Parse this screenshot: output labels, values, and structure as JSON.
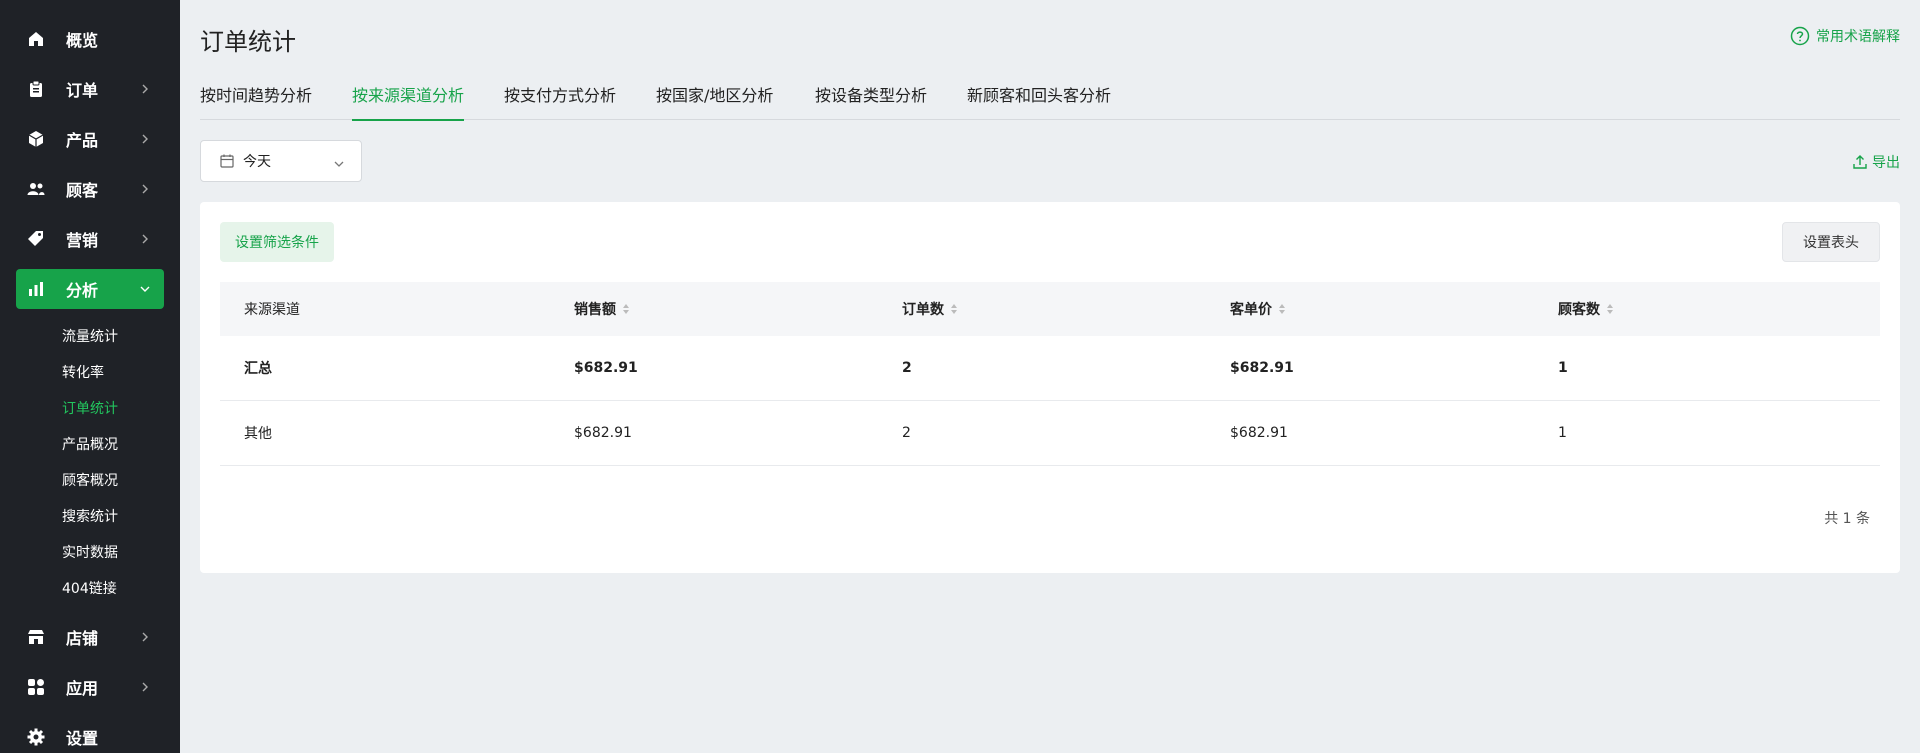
{
  "sidebar": {
    "items": [
      {
        "label": "概览",
        "icon": "home-icon"
      },
      {
        "label": "订单",
        "icon": "clipboard-icon"
      },
      {
        "label": "产品",
        "icon": "box-icon"
      },
      {
        "label": "顾客",
        "icon": "users-icon"
      },
      {
        "label": "营销",
        "icon": "tag-icon"
      },
      {
        "label": "分析",
        "icon": "bar-chart-icon"
      },
      {
        "label": "店铺",
        "icon": "store-icon"
      },
      {
        "label": "应用",
        "icon": "apps-icon"
      },
      {
        "label": "设置",
        "icon": "gear-icon"
      }
    ],
    "sub_items": [
      "流量统计",
      "转化率",
      "订单统计",
      "产品概况",
      "顾客概况",
      "搜索统计",
      "实时数据",
      "404链接"
    ],
    "active_sub": "订单统计"
  },
  "header": {
    "title": "订单统计",
    "help_label": "常用术语解释"
  },
  "tabs": [
    "按时间趋势分析",
    "按来源渠道分析",
    "按支付方式分析",
    "按国家/地区分析",
    "按设备类型分析",
    "新顾客和回头客分析"
  ],
  "active_tab": "按来源渠道分析",
  "date_picker": {
    "value": "今天"
  },
  "export_label": "导出",
  "toolbar": {
    "filter_label": "设置筛选条件",
    "columns_label": "设置表头"
  },
  "table": {
    "columns": [
      "来源渠道",
      "销售额",
      "订单数",
      "客单价",
      "顾客数"
    ],
    "summary": [
      "汇总",
      "$682.91",
      "2",
      "$682.91",
      "1"
    ],
    "rows": [
      [
        "其他",
        "$682.91",
        "2",
        "$682.91",
        "1"
      ]
    ]
  },
  "pagination": {
    "total_label": "共 1 条"
  },
  "colors": {
    "accent": "#17a34a",
    "sidebar_bg": "#1f2227",
    "page_bg": "#eceff2"
  }
}
